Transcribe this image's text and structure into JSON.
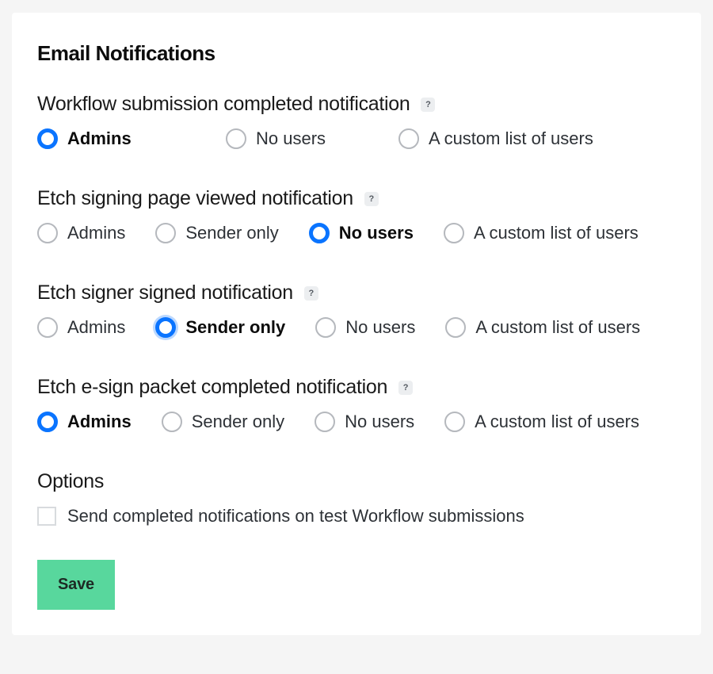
{
  "title": "Email Notifications",
  "sections": [
    {
      "heading": "Workflow submission completed notification",
      "help": "?",
      "selected": 0,
      "options": [
        {
          "label": "Admins"
        },
        {
          "label": "No users"
        },
        {
          "label": "A custom list of users"
        }
      ]
    },
    {
      "heading": "Etch signing page viewed notification",
      "help": "?",
      "selected": 2,
      "options": [
        {
          "label": "Admins"
        },
        {
          "label": "Sender only"
        },
        {
          "label": "No users"
        },
        {
          "label": "A custom list of users"
        }
      ]
    },
    {
      "heading": "Etch signer signed notification",
      "help": "?",
      "selected": 1,
      "halo": true,
      "options": [
        {
          "label": "Admins"
        },
        {
          "label": "Sender only"
        },
        {
          "label": "No users"
        },
        {
          "label": "A custom list of users"
        }
      ]
    },
    {
      "heading": "Etch e-sign packet completed notification",
      "help": "?",
      "selected": 0,
      "options": [
        {
          "label": "Admins"
        },
        {
          "label": "Sender only"
        },
        {
          "label": "No users"
        },
        {
          "label": "A custom list of users"
        }
      ]
    }
  ],
  "options_heading": "Options",
  "checkbox_label": "Send completed notifications on test Workflow submissions",
  "checkbox_checked": false,
  "save_label": "Save"
}
